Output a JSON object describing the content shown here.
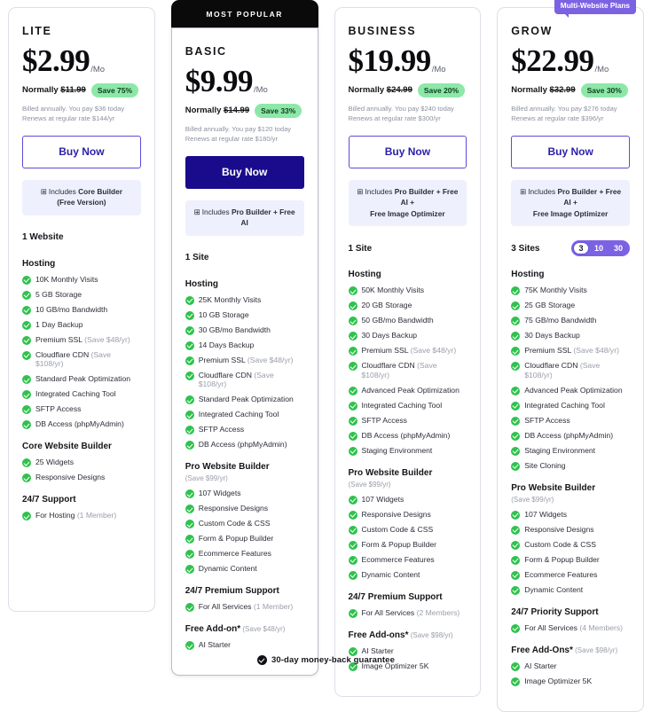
{
  "footer": {
    "text": "30-day money-back guarantee",
    "icon": "guarantee-check-icon"
  },
  "plans": [
    {
      "name": "LITE",
      "popular_label": "",
      "price": "$2.99",
      "per": "/Mo",
      "normally_prefix": "Normally ",
      "normally_price": "$11.99",
      "save_badge": "Save 75%",
      "fine1": "Billed annually. You pay $36 today",
      "fine2": "Renews at regular rate $144/yr",
      "buy_label": "Buy Now",
      "includes_line1_plain": "Includes ",
      "includes_line1_bold": "Core Builder",
      "includes_line2": "(Free Version)",
      "sites_label": "1 Website",
      "toggle": null,
      "badge": null,
      "sections": [
        {
          "title": "Hosting",
          "subtitle": "",
          "features": [
            {
              "text": "10K Monthly Visits",
              "muted": ""
            },
            {
              "text": "5 GB Storage",
              "muted": ""
            },
            {
              "text": "10 GB/mo Bandwidth",
              "muted": ""
            },
            {
              "text": "1 Day Backup",
              "muted": ""
            },
            {
              "text": "Premium SSL ",
              "muted": "(Save $48/yr)"
            },
            {
              "text": "Cloudflare CDN ",
              "muted": "(Save $108/yr)"
            },
            {
              "text": "Standard Peak Optimization",
              "muted": ""
            },
            {
              "text": "Integrated Caching Tool",
              "muted": ""
            },
            {
              "text": "SFTP Access",
              "muted": ""
            },
            {
              "text": "DB Access (phpMyAdmin)",
              "muted": ""
            }
          ]
        },
        {
          "title": "Core Website Builder",
          "subtitle": "",
          "features": [
            {
              "text": "25 Widgets",
              "muted": ""
            },
            {
              "text": "Responsive Designs",
              "muted": ""
            }
          ]
        },
        {
          "title": "24/7 Support",
          "subtitle": "",
          "features": [
            {
              "text": "For Hosting ",
              "muted": "(1 Member)"
            }
          ]
        }
      ]
    },
    {
      "name": "BASIC",
      "popular_label": "MOST POPULAR",
      "price": "$9.99",
      "per": "/Mo",
      "normally_prefix": "Normally ",
      "normally_price": "$14.99",
      "save_badge": "Save 33%",
      "fine1": "Billed annually. You pay $120 today",
      "fine2": "Renews at regular rate $180/yr",
      "buy_label": "Buy Now",
      "includes_line1_plain": "Includes ",
      "includes_line1_bold": "Pro Builder + Free AI",
      "includes_line2": "",
      "sites_label": "1 Site",
      "toggle": null,
      "badge": null,
      "sections": [
        {
          "title": "Hosting",
          "subtitle": "",
          "features": [
            {
              "text": "25K Monthly Visits",
              "muted": ""
            },
            {
              "text": "10 GB Storage",
              "muted": ""
            },
            {
              "text": "30 GB/mo Bandwidth",
              "muted": ""
            },
            {
              "text": "14 Days Backup",
              "muted": ""
            },
            {
              "text": "Premium SSL ",
              "muted": "(Save $48/yr)"
            },
            {
              "text": "Cloudflare CDN ",
              "muted": "(Save $108/yr)"
            },
            {
              "text": "Standard Peak Optimization",
              "muted": ""
            },
            {
              "text": "Integrated Caching Tool",
              "muted": ""
            },
            {
              "text": "SFTP Access",
              "muted": ""
            },
            {
              "text": "DB Access (phpMyAdmin)",
              "muted": ""
            }
          ]
        },
        {
          "title": "Pro Website Builder",
          "subtitle": "(Save $99/yr)",
          "features": [
            {
              "text": "107 Widgets",
              "muted": ""
            },
            {
              "text": "Responsive Designs",
              "muted": ""
            },
            {
              "text": "Custom Code & CSS",
              "muted": ""
            },
            {
              "text": "Form & Popup Builder",
              "muted": ""
            },
            {
              "text": "Ecommerce Features",
              "muted": ""
            },
            {
              "text": "Dynamic Content",
              "muted": ""
            }
          ]
        },
        {
          "title": "24/7 Premium Support",
          "subtitle": "",
          "features": [
            {
              "text": "For All Services ",
              "muted": "(1 Member)"
            }
          ]
        },
        {
          "title": "Free Add-on*",
          "subtitle_inline": " (Save $48/yr)",
          "features": [
            {
              "text": "AI Starter",
              "muted": ""
            }
          ]
        }
      ]
    },
    {
      "name": "BUSINESS",
      "popular_label": "",
      "price": "$19.99",
      "per": "/Mo",
      "normally_prefix": "Normally ",
      "normally_price": "$24.99",
      "save_badge": "Save 20%",
      "fine1": "Billed annually. You pay $240 today",
      "fine2": "Renews at regular rate $300/yr",
      "buy_label": "Buy Now",
      "includes_line1_plain": "Includes ",
      "includes_line1_bold": "Pro Builder + Free AI +",
      "includes_line2": "Free Image Optimizer",
      "sites_label": "1 Site",
      "toggle": null,
      "badge": null,
      "sections": [
        {
          "title": "Hosting",
          "subtitle": "",
          "features": [
            {
              "text": "50K Monthly Visits",
              "muted": ""
            },
            {
              "text": "20 GB Storage",
              "muted": ""
            },
            {
              "text": "50 GB/mo Bandwidth",
              "muted": ""
            },
            {
              "text": "30 Days Backup",
              "muted": ""
            },
            {
              "text": "Premium SSL ",
              "muted": "(Save $48/yr)"
            },
            {
              "text": "Cloudflare CDN ",
              "muted": "(Save $108/yr)"
            },
            {
              "text": "Advanced Peak Optimization",
              "muted": ""
            },
            {
              "text": "Integrated Caching Tool",
              "muted": ""
            },
            {
              "text": "SFTP Access",
              "muted": ""
            },
            {
              "text": "DB Access (phpMyAdmin)",
              "muted": ""
            },
            {
              "text": "Staging Environment",
              "muted": ""
            }
          ]
        },
        {
          "title": "Pro Website Builder",
          "subtitle": "(Save $99/yr)",
          "features": [
            {
              "text": "107 Widgets",
              "muted": ""
            },
            {
              "text": "Responsive Designs",
              "muted": ""
            },
            {
              "text": "Custom Code & CSS",
              "muted": ""
            },
            {
              "text": "Form & Popup Builder",
              "muted": ""
            },
            {
              "text": "Ecommerce Features",
              "muted": ""
            },
            {
              "text": "Dynamic Content",
              "muted": ""
            }
          ]
        },
        {
          "title": "24/7 Premium Support",
          "subtitle": "",
          "features": [
            {
              "text": "For All Services ",
              "muted": "(2 Members)"
            }
          ]
        },
        {
          "title": "Free Add-ons*",
          "subtitle_inline": " (Save $98/yr)",
          "features": [
            {
              "text": "AI Starter",
              "muted": ""
            },
            {
              "text": "Image Optimizer 5K",
              "muted": ""
            }
          ]
        }
      ]
    },
    {
      "name": "GROW",
      "popular_label": "",
      "price": "$22.99",
      "per": "/Mo",
      "normally_prefix": "Normally ",
      "normally_price": "$32.99",
      "save_badge": "Save 30%",
      "fine1": "Billed annually. You pay $276 today",
      "fine2": "Renews at regular rate $396/yr",
      "buy_label": "Buy Now",
      "includes_line1_plain": "Includes ",
      "includes_line1_bold": "Pro Builder + Free AI +",
      "includes_line2": "Free Image Optimizer",
      "sites_label": "3 Sites",
      "toggle": {
        "options": [
          "3",
          "10",
          "30"
        ],
        "selected": "3"
      },
      "badge": "Multi-Website Plans",
      "sections": [
        {
          "title": "Hosting",
          "subtitle": "",
          "features": [
            {
              "text": "75K Monthly Visits",
              "muted": ""
            },
            {
              "text": "25 GB Storage",
              "muted": ""
            },
            {
              "text": "75 GB/mo Bandwidth",
              "muted": ""
            },
            {
              "text": "30 Days Backup",
              "muted": ""
            },
            {
              "text": "Premium SSL ",
              "muted": "(Save $48/yr)"
            },
            {
              "text": "Cloudflare CDN ",
              "muted": "(Save $108/yr)"
            },
            {
              "text": "Advanced Peak Optimization",
              "muted": ""
            },
            {
              "text": "Integrated Caching Tool",
              "muted": ""
            },
            {
              "text": "SFTP Access",
              "muted": ""
            },
            {
              "text": "DB Access (phpMyAdmin)",
              "muted": ""
            },
            {
              "text": "Staging Environment",
              "muted": ""
            },
            {
              "text": "Site Cloning",
              "muted": ""
            }
          ]
        },
        {
          "title": "Pro Website Builder",
          "subtitle": "(Save $99/yr)",
          "features": [
            {
              "text": "107 Widgets",
              "muted": ""
            },
            {
              "text": "Responsive Designs",
              "muted": ""
            },
            {
              "text": "Custom Code & CSS",
              "muted": ""
            },
            {
              "text": "Form & Popup Builder",
              "muted": ""
            },
            {
              "text": "Ecommerce Features",
              "muted": ""
            },
            {
              "text": "Dynamic Content",
              "muted": ""
            }
          ]
        },
        {
          "title": "24/7 Priority Support",
          "subtitle": "",
          "features": [
            {
              "text": "For All Services ",
              "muted": "(4 Members)"
            }
          ]
        },
        {
          "title": "Free Add-Ons*",
          "subtitle_inline": " (Save $98/yr)",
          "features": [
            {
              "text": "AI Starter",
              "muted": ""
            },
            {
              "text": "Image Optimizer 5K",
              "muted": ""
            }
          ]
        }
      ]
    }
  ]
}
